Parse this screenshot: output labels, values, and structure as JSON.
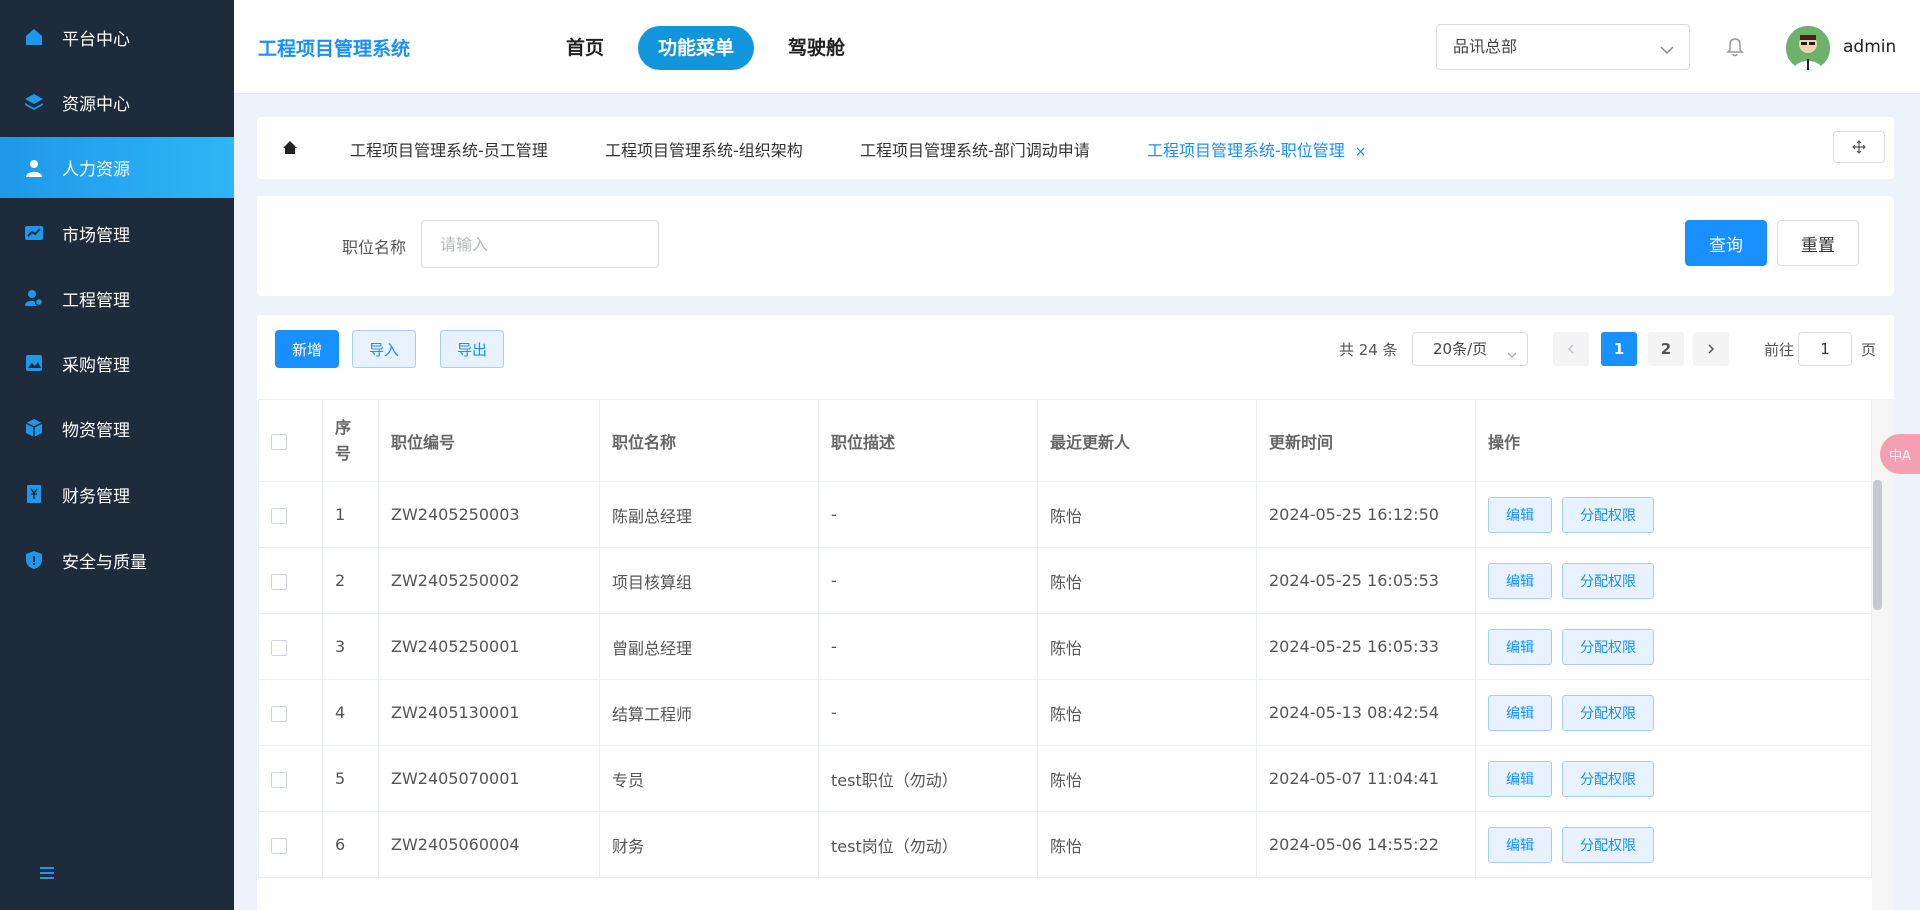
{
  "sidebar": {
    "items": [
      {
        "label": "平台中心",
        "icon": "home-icon"
      },
      {
        "label": "资源中心",
        "icon": "layers-icon"
      },
      {
        "label": "人力资源",
        "icon": "user-icon",
        "active": true
      },
      {
        "label": "市场管理",
        "icon": "chart-icon"
      },
      {
        "label": "工程管理",
        "icon": "people-gear-icon"
      },
      {
        "label": "采购管理",
        "icon": "image-icon"
      },
      {
        "label": "物资管理",
        "icon": "cube-icon"
      },
      {
        "label": "财务管理",
        "icon": "ledger-icon"
      },
      {
        "label": "安全与质量",
        "icon": "shield-icon"
      }
    ],
    "toggle_icon": "menu-icon"
  },
  "header": {
    "app_title": "工程项目管理系统",
    "nav": [
      {
        "label": "首页"
      },
      {
        "label": "功能菜单",
        "active": true
      },
      {
        "label": "驾驶舱"
      }
    ],
    "org_select": "品讯总部",
    "username": "admin"
  },
  "tabs": [
    {
      "label": "工程项目管理系统-员工管理"
    },
    {
      "label": "工程项目管理系统-组织架构"
    },
    {
      "label": "工程项目管理系统-部门调动申请"
    },
    {
      "label": "工程项目管理系统-职位管理",
      "active": true,
      "close": "×"
    }
  ],
  "search": {
    "label": "职位名称",
    "placeholder": "请输入",
    "query_label": "查询",
    "reset_label": "重置"
  },
  "toolbar": {
    "add_label": "新增",
    "import_label": "导入",
    "export_label": "导出"
  },
  "pagination": {
    "total_text": "共 24 条",
    "page_size": "20条/页",
    "pages": [
      "1",
      "2"
    ],
    "current_page": "1",
    "goto_label": "前往",
    "goto_value": "1",
    "goto_suffix": "页"
  },
  "table": {
    "columns": [
      "序号",
      "职位编号",
      "职位名称",
      "职位描述",
      "最近更新人",
      "更新时间",
      "操作"
    ],
    "edit_label": "编辑",
    "perm_label": "分配权限",
    "rows": [
      {
        "no": "1",
        "code": "ZW2405250003",
        "name": "陈副总经理",
        "desc": "-",
        "updater": "陈怡",
        "time": "2024-05-25 16:12:50"
      },
      {
        "no": "2",
        "code": "ZW2405250002",
        "name": "项目核算组",
        "desc": "-",
        "updater": "陈怡",
        "time": "2024-05-25 16:05:53"
      },
      {
        "no": "3",
        "code": "ZW2405250001",
        "name": "曾副总经理",
        "desc": "-",
        "updater": "陈怡",
        "time": "2024-05-25 16:05:33"
      },
      {
        "no": "4",
        "code": "ZW2405130001",
        "name": "结算工程师",
        "desc": "-",
        "updater": "陈怡",
        "time": "2024-05-13 08:42:54"
      },
      {
        "no": "5",
        "code": "ZW2405070001",
        "name": "专员",
        "desc": "test职位（勿动）",
        "updater": "陈怡",
        "time": "2024-05-07 11:04:41"
      },
      {
        "no": "6",
        "code": "ZW2405060004",
        "name": "财务",
        "desc": "test岗位（勿动）",
        "updater": "陈怡",
        "time": "2024-05-06 14:55:22"
      }
    ]
  },
  "float_widget": "中A",
  "colors": {
    "primary": "#1890ff",
    "sidebar_bg": "#1d2b3a",
    "sidebar_active": "#1e98ea",
    "nav_active": "#1296db"
  }
}
